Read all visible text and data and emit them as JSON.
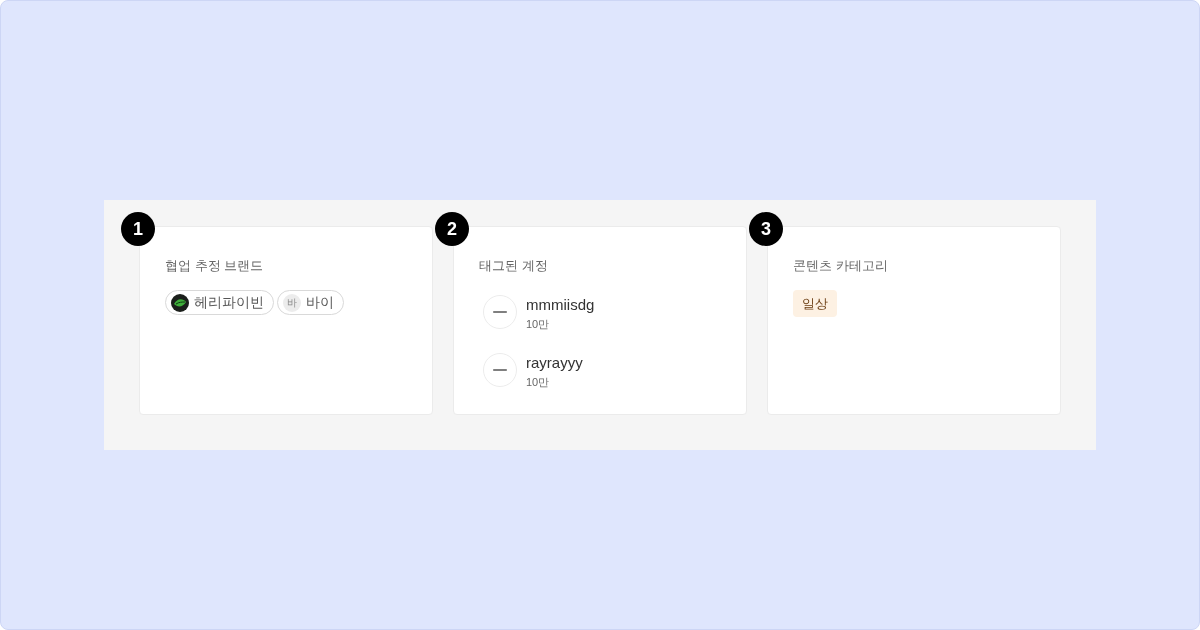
{
  "panels": [
    {
      "number": "1",
      "title": "협업 추정 브랜드",
      "kind": "brands",
      "brands": [
        {
          "name": "헤리파이빈"
        },
        {
          "name": "바이",
          "initial": "바"
        }
      ]
    },
    {
      "number": "2",
      "title": "태그된 계정",
      "kind": "accounts",
      "accounts": [
        {
          "username": "mmmiisdg",
          "followers": "10만"
        },
        {
          "username": "rayrayyy",
          "followers": "10만"
        }
      ]
    },
    {
      "number": "3",
      "title": "콘텐츠 카테고리",
      "kind": "categories",
      "categories": [
        {
          "label": "일상"
        }
      ]
    }
  ]
}
